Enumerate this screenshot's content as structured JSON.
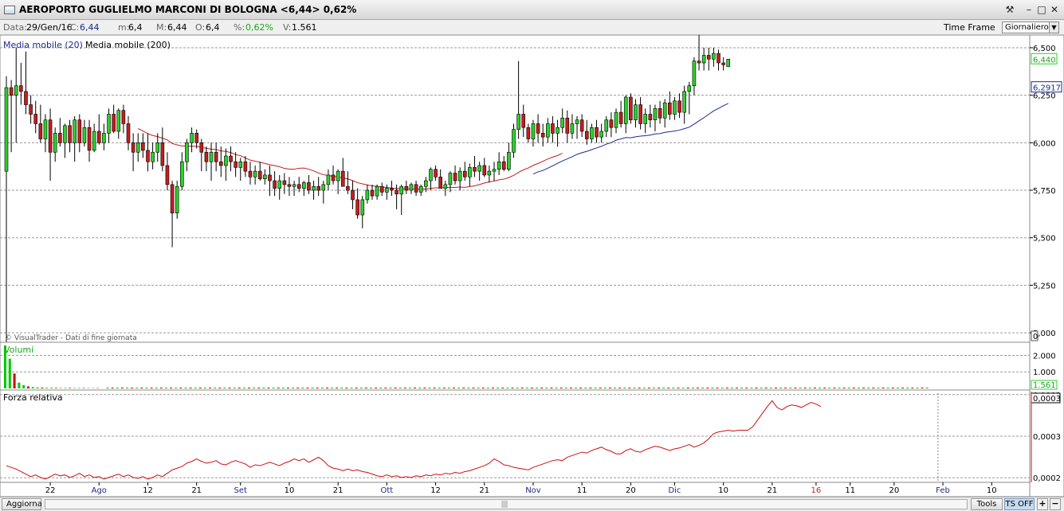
{
  "window": {
    "title": "AEROPORTO GUGLIELMO MARCONI DI BOLOGNA <6,44> 0,62%",
    "buttons": {
      "tools_icon": "wrench-icon",
      "minimize": "–",
      "restore": "□",
      "close": "✕"
    }
  },
  "infobar": {
    "date_label": "Data:",
    "date": "29/Gen/16",
    "close_label": "C:",
    "close": "6,44",
    "min_label": "m:",
    "min": "6,4",
    "max_label": "M:",
    "max": "6,44",
    "open_label": "O:",
    "open": "6,4",
    "pct_label": "%:",
    "pct": "0,62%",
    "vol_label": "V:",
    "vol": "1.561",
    "timeframe_label": "Time Frame",
    "timeframe_value": "Giornaliero"
  },
  "bottom": {
    "refresh_label": "Aggiorna",
    "tools_label": "Tools",
    "tsoff_label": "TS OFF",
    "plus": "+",
    "minus": "−"
  },
  "colors": {
    "up": "#2bd12b",
    "down": "#c41e1e",
    "ma20": "#1b2a8c",
    "ma200": "#c41e1e",
    "grid": "#9a9a9a",
    "volume_up": "#00c800",
    "volume_down": "#d00000",
    "rs_line": "#cc1010"
  },
  "chart_data": [
    {
      "type": "candlestick",
      "title": "",
      "source_note": "© VisualTrader - Dati di fine giornata",
      "legend": [
        "Media mobile (20)",
        "Media mobile (200)"
      ],
      "ylim": [
        4.95,
        6.55
      ],
      "yticks": [
        "6,500",
        "6,250",
        "6,000",
        "5,750",
        "5,500",
        "5,250",
        "5,000"
      ],
      "ytick_values": [
        6.5,
        6.25,
        6.0,
        5.75,
        5.5,
        5.25,
        5.0
      ],
      "last_price_label": "6,440",
      "ma_label": "6,2917",
      "xticks": [
        {
          "label": "22",
          "idx": 9,
          "month": false
        },
        {
          "label": "Ago",
          "idx": 19,
          "month": true
        },
        {
          "label": "12",
          "idx": 29,
          "month": false
        },
        {
          "label": "21",
          "idx": 39,
          "month": false
        },
        {
          "label": "Set",
          "idx": 48,
          "month": true
        },
        {
          "label": "10",
          "idx": 58,
          "month": false
        },
        {
          "label": "21",
          "idx": 68,
          "month": false
        },
        {
          "label": "Ott",
          "idx": 78,
          "month": true
        },
        {
          "label": "12",
          "idx": 88,
          "month": false
        },
        {
          "label": "21",
          "idx": 98,
          "month": false
        },
        {
          "label": "Nov",
          "idx": 108,
          "month": true
        },
        {
          "label": "11",
          "idx": 118,
          "month": false
        },
        {
          "label": "20",
          "idx": 128,
          "month": false
        },
        {
          "label": "Dic",
          "idx": 137,
          "month": true
        },
        {
          "label": "10",
          "idx": 147,
          "month": false
        },
        {
          "label": "21",
          "idx": 157,
          "month": false
        },
        {
          "label": "16",
          "idx": 166,
          "month": true,
          "year": true
        },
        {
          "label": "11",
          "idx": 173,
          "month": false
        },
        {
          "label": "20",
          "idx": 182,
          "month": false
        },
        {
          "label": "Feb",
          "idx": 192,
          "month": true
        },
        {
          "label": "10",
          "idx": 202,
          "month": false
        }
      ],
      "ma_start": {
        "ma20": 128,
        "ma200": 27
      },
      "ohlc": [
        [
          5.85,
          6.35,
          4.95,
          6.29
        ],
        [
          6.29,
          6.33,
          5.95,
          6.25
        ],
        [
          6.25,
          6.5,
          6.0,
          6.3
        ],
        [
          6.3,
          6.42,
          6.2,
          6.27
        ],
        [
          6.27,
          6.48,
          6.15,
          6.2
        ],
        [
          6.2,
          6.25,
          6.1,
          6.15
        ],
        [
          6.15,
          6.22,
          6.05,
          6.1
        ],
        [
          6.1,
          6.2,
          6.0,
          6.02
        ],
        [
          6.02,
          6.15,
          5.95,
          6.12
        ],
        [
          6.12,
          6.18,
          5.8,
          5.95
        ],
        [
          5.95,
          6.08,
          5.9,
          6.05
        ],
        [
          6.05,
          6.13,
          5.98,
          6.0
        ],
        [
          6.0,
          6.1,
          5.92,
          6.09
        ],
        [
          6.09,
          6.12,
          5.95,
          6.0
        ],
        [
          6.0,
          6.14,
          5.9,
          6.12
        ],
        [
          6.12,
          6.15,
          5.95,
          6.0
        ],
        [
          6.0,
          6.12,
          5.98,
          6.08
        ],
        [
          6.08,
          6.12,
          5.9,
          5.96
        ],
        [
          5.96,
          6.1,
          5.95,
          6.06
        ],
        [
          6.06,
          6.15,
          5.99,
          6.0
        ],
        [
          6.0,
          6.1,
          5.96,
          6.05
        ],
        [
          6.05,
          6.18,
          6.0,
          6.15
        ],
        [
          6.15,
          6.2,
          6.05,
          6.06
        ],
        [
          6.06,
          6.18,
          6.02,
          6.17
        ],
        [
          6.17,
          6.2,
          6.05,
          6.1
        ],
        [
          6.1,
          6.14,
          5.96,
          6.0
        ],
        [
          6.0,
          6.05,
          5.85,
          5.95
        ],
        [
          5.95,
          6.05,
          5.9,
          6.0
        ],
        [
          6.0,
          6.05,
          5.92,
          5.96
        ],
        [
          5.96,
          6.05,
          5.85,
          5.9
        ],
        [
          5.9,
          6.0,
          5.86,
          5.95
        ],
        [
          5.95,
          6.05,
          5.9,
          6.0
        ],
        [
          6.0,
          6.08,
          5.85,
          5.88
        ],
        [
          5.88,
          5.95,
          5.75,
          5.78
        ],
        [
          5.78,
          5.8,
          5.45,
          5.63
        ],
        [
          5.63,
          5.8,
          5.6,
          5.77
        ],
        [
          5.77,
          5.95,
          5.75,
          5.9
        ],
        [
          5.9,
          6.02,
          5.85,
          6.0
        ],
        [
          6.0,
          6.08,
          5.95,
          6.05
        ],
        [
          6.05,
          6.07,
          5.97,
          6.0
        ],
        [
          6.0,
          6.02,
          5.85,
          5.95
        ],
        [
          5.95,
          5.98,
          5.85,
          5.9
        ],
        [
          5.9,
          6.0,
          5.8,
          5.95
        ],
        [
          5.95,
          6.0,
          5.85,
          5.9
        ],
        [
          5.9,
          5.98,
          5.82,
          5.88
        ],
        [
          5.88,
          5.97,
          5.8,
          5.93
        ],
        [
          5.93,
          5.98,
          5.85,
          5.9
        ],
        [
          5.9,
          5.95,
          5.82,
          5.87
        ],
        [
          5.87,
          5.92,
          5.8,
          5.9
        ],
        [
          5.9,
          5.93,
          5.82,
          5.85
        ],
        [
          5.85,
          5.9,
          5.78,
          5.82
        ],
        [
          5.82,
          5.88,
          5.78,
          5.85
        ],
        [
          5.85,
          5.9,
          5.8,
          5.81
        ],
        [
          5.81,
          5.86,
          5.78,
          5.83
        ],
        [
          5.83,
          5.88,
          5.72,
          5.8
        ],
        [
          5.8,
          5.85,
          5.72,
          5.76
        ],
        [
          5.76,
          5.83,
          5.7,
          5.8
        ],
        [
          5.8,
          5.84,
          5.73,
          5.78
        ],
        [
          5.78,
          5.82,
          5.72,
          5.77
        ],
        [
          5.77,
          5.8,
          5.72,
          5.78
        ],
        [
          5.78,
          5.82,
          5.74,
          5.76
        ],
        [
          5.76,
          5.8,
          5.72,
          5.79
        ],
        [
          5.79,
          5.83,
          5.73,
          5.75
        ],
        [
          5.75,
          5.8,
          5.7,
          5.77
        ],
        [
          5.77,
          5.82,
          5.72,
          5.75
        ],
        [
          5.75,
          5.8,
          5.68,
          5.78
        ],
        [
          5.78,
          5.86,
          5.75,
          5.83
        ],
        [
          5.83,
          5.88,
          5.78,
          5.8
        ],
        [
          5.8,
          5.86,
          5.73,
          5.85
        ],
        [
          5.85,
          5.92,
          5.78,
          5.77
        ],
        [
          5.77,
          5.85,
          5.73,
          5.75
        ],
        [
          5.75,
          5.8,
          5.65,
          5.7
        ],
        [
          5.7,
          5.76,
          5.6,
          5.62
        ],
        [
          5.62,
          5.72,
          5.55,
          5.7
        ],
        [
          5.7,
          5.78,
          5.68,
          5.75
        ],
        [
          5.75,
          5.78,
          5.7,
          5.72
        ],
        [
          5.72,
          5.78,
          5.7,
          5.77
        ],
        [
          5.77,
          5.79,
          5.72,
          5.74
        ],
        [
          5.74,
          5.78,
          5.7,
          5.76
        ],
        [
          5.76,
          5.8,
          5.72,
          5.75
        ],
        [
          5.75,
          5.78,
          5.65,
          5.73
        ],
        [
          5.73,
          5.78,
          5.62,
          5.77
        ],
        [
          5.77,
          5.8,
          5.73,
          5.75
        ],
        [
          5.75,
          5.79,
          5.73,
          5.78
        ],
        [
          5.78,
          5.8,
          5.72,
          5.74
        ],
        [
          5.74,
          5.78,
          5.72,
          5.77
        ],
        [
          5.77,
          5.82,
          5.74,
          5.8
        ],
        [
          5.8,
          5.87,
          5.75,
          5.86
        ],
        [
          5.86,
          5.88,
          5.8,
          5.82
        ],
        [
          5.82,
          5.86,
          5.77,
          5.76
        ],
        [
          5.76,
          5.8,
          5.72,
          5.78
        ],
        [
          5.78,
          5.85,
          5.74,
          5.84
        ],
        [
          5.84,
          5.88,
          5.78,
          5.8
        ],
        [
          5.8,
          5.87,
          5.75,
          5.85
        ],
        [
          5.85,
          5.9,
          5.8,
          5.82
        ],
        [
          5.82,
          5.89,
          5.77,
          5.87
        ],
        [
          5.87,
          5.93,
          5.82,
          5.85
        ],
        [
          5.85,
          5.9,
          5.8,
          5.88
        ],
        [
          5.88,
          5.92,
          5.82,
          5.83
        ],
        [
          5.83,
          5.88,
          5.79,
          5.85
        ],
        [
          5.85,
          5.9,
          5.8,
          5.86
        ],
        [
          5.86,
          5.95,
          5.83,
          5.9
        ],
        [
          5.9,
          5.93,
          5.85,
          5.86
        ],
        [
          5.86,
          6.0,
          5.85,
          5.95
        ],
        [
          5.95,
          6.1,
          5.92,
          6.07
        ],
        [
          6.07,
          6.43,
          6.02,
          6.15
        ],
        [
          6.15,
          6.2,
          6.03,
          6.08
        ],
        [
          6.08,
          6.1,
          6.0,
          6.02
        ],
        [
          6.02,
          6.12,
          5.98,
          6.1
        ],
        [
          6.1,
          6.15,
          6.0,
          6.05
        ],
        [
          6.05,
          6.1,
          5.98,
          6.03
        ],
        [
          6.03,
          6.13,
          6.0,
          6.1
        ],
        [
          6.1,
          6.14,
          6.0,
          6.05
        ],
        [
          6.05,
          6.12,
          5.98,
          6.08
        ],
        [
          6.08,
          6.18,
          6.05,
          6.13
        ],
        [
          6.13,
          6.17,
          6.0,
          6.05
        ],
        [
          6.05,
          6.15,
          6.02,
          6.1
        ],
        [
          6.1,
          6.14,
          6.02,
          6.12
        ],
        [
          6.12,
          6.15,
          6.03,
          6.06
        ],
        [
          6.06,
          6.12,
          5.99,
          6.02
        ],
        [
          6.02,
          6.1,
          6.0,
          6.08
        ],
        [
          6.08,
          6.12,
          6.0,
          6.03
        ],
        [
          6.03,
          6.1,
          6.0,
          6.06
        ],
        [
          6.06,
          6.14,
          6.03,
          6.12
        ],
        [
          6.12,
          6.16,
          6.03,
          6.08
        ],
        [
          6.08,
          6.18,
          6.05,
          6.16
        ],
        [
          6.16,
          6.22,
          6.08,
          6.1
        ],
        [
          6.1,
          6.25,
          6.05,
          6.24
        ],
        [
          6.24,
          6.26,
          6.1,
          6.12
        ],
        [
          6.12,
          6.23,
          6.08,
          6.2
        ],
        [
          6.2,
          6.24,
          6.07,
          6.1
        ],
        [
          6.1,
          6.18,
          6.05,
          6.15
        ],
        [
          6.15,
          6.2,
          6.08,
          6.12
        ],
        [
          6.12,
          6.2,
          6.06,
          6.18
        ],
        [
          6.18,
          6.22,
          6.1,
          6.13
        ],
        [
          6.13,
          6.23,
          6.08,
          6.21
        ],
        [
          6.21,
          6.27,
          6.12,
          6.15
        ],
        [
          6.15,
          6.24,
          6.12,
          6.22
        ],
        [
          6.22,
          6.26,
          6.13,
          6.16
        ],
        [
          6.16,
          6.3,
          6.1,
          6.27
        ],
        [
          6.27,
          6.32,
          6.15,
          6.3
        ],
        [
          6.3,
          6.45,
          6.25,
          6.43
        ],
        [
          6.43,
          6.58,
          6.38,
          6.42
        ],
        [
          6.42,
          6.5,
          6.38,
          6.46
        ],
        [
          6.46,
          6.5,
          6.38,
          6.44
        ],
        [
          6.44,
          6.5,
          6.4,
          6.47
        ],
        [
          6.47,
          6.49,
          6.38,
          6.42
        ],
        [
          6.42,
          6.45,
          6.38,
          6.41
        ],
        [
          6.4,
          6.44,
          6.4,
          6.44
        ]
      ]
    },
    {
      "type": "bar",
      "title": "Volumi",
      "yticks": [
        "2.000",
        "1.000"
      ],
      "ytick_values": [
        2000,
        1000
      ],
      "ylim": [
        0,
        2600
      ],
      "last_label": "1.561",
      "zero_label": "0",
      "values": [
        2600,
        1800,
        900,
        350,
        200,
        120,
        80,
        60,
        50,
        40,
        40,
        35,
        30,
        30,
        30,
        25,
        25,
        25,
        20,
        20,
        20
      ]
    },
    {
      "type": "line",
      "title": "Forza relativa",
      "yticks": [
        "0,0003",
        "0,0003",
        "0,0002"
      ],
      "ytick_fracs": [
        0.05,
        0.5,
        0.95
      ],
      "last_label": "0,0003",
      "values": [
        0.16,
        0.14,
        0.12,
        0.09,
        0.06,
        0.03,
        0.05,
        0.02,
        0.0,
        0.03,
        0.06,
        0.04,
        0.05,
        0.02,
        0.04,
        0.07,
        0.03,
        0.05,
        0.02,
        0.03,
        0.0,
        0.02,
        0.04,
        0.06,
        0.03,
        0.05,
        0.02,
        0.01,
        0.03,
        0.0,
        0.02,
        0.05,
        0.03,
        0.07,
        0.11,
        0.13,
        0.15,
        0.19,
        0.21,
        0.24,
        0.21,
        0.19,
        0.2,
        0.22,
        0.18,
        0.17,
        0.2,
        0.22,
        0.2,
        0.18,
        0.14,
        0.17,
        0.16,
        0.18,
        0.2,
        0.18,
        0.16,
        0.19,
        0.21,
        0.24,
        0.22,
        0.24,
        0.2,
        0.23,
        0.26,
        0.22,
        0.16,
        0.13,
        0.12,
        0.1,
        0.12,
        0.1,
        0.11,
        0.09,
        0.08,
        0.06,
        0.04,
        0.03,
        0.05,
        0.03,
        0.04,
        0.02,
        0.03,
        0.02,
        0.04,
        0.03,
        0.05,
        0.04,
        0.06,
        0.05,
        0.07,
        0.06,
        0.08,
        0.07,
        0.09,
        0.1,
        0.12,
        0.14,
        0.16,
        0.19,
        0.24,
        0.21,
        0.17,
        0.16,
        0.14,
        0.13,
        0.12,
        0.11,
        0.14,
        0.16,
        0.18,
        0.2,
        0.22,
        0.23,
        0.22,
        0.26,
        0.28,
        0.3,
        0.32,
        0.31,
        0.34,
        0.36,
        0.38,
        0.35,
        0.33,
        0.3,
        0.3,
        0.34,
        0.36,
        0.33,
        0.32,
        0.35,
        0.37,
        0.39,
        0.38,
        0.36,
        0.34,
        0.36,
        0.37,
        0.39,
        0.41,
        0.38,
        0.4,
        0.43,
        0.48,
        0.54,
        0.56,
        0.57,
        0.58,
        0.57,
        0.58,
        0.58,
        0.58,
        0.62,
        0.7,
        0.78,
        0.86,
        0.93,
        0.85,
        0.82,
        0.86,
        0.88,
        0.87,
        0.85,
        0.88,
        0.91,
        0.89,
        0.86
      ]
    }
  ]
}
